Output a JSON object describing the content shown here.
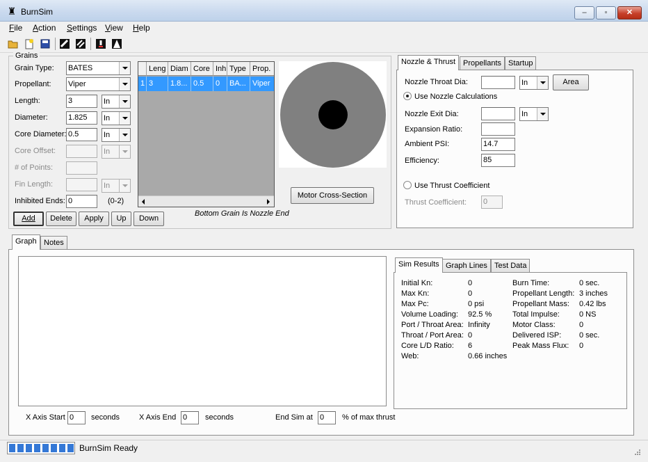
{
  "window": {
    "title": "BurnSim",
    "minimize_glyph": "–",
    "maximize_glyph": "▫",
    "close_glyph": "✕"
  },
  "menu": [
    {
      "label": "File",
      "accel": "F",
      "rest": "ile"
    },
    {
      "label": "Action",
      "accel": "A",
      "rest": "ction"
    },
    {
      "label": "Settings",
      "accel": "S",
      "rest": "ettings"
    },
    {
      "label": "View",
      "accel": "V",
      "rest": "iew"
    },
    {
      "label": "Help",
      "accel": "H",
      "rest": "elp"
    }
  ],
  "toolbar_icons": [
    "open-folder-icon",
    "new-file-icon",
    "save-disk-icon",
    "grain-tool-1-icon",
    "grain-tool-2-icon",
    "run-sim-icon",
    "motor-icon"
  ],
  "grains": {
    "legend": "Grains",
    "grain_type_label": "Grain Type:",
    "grain_type": "BATES",
    "propellant_label": "Propellant:",
    "propellant": "Viper",
    "length_label": "Length:",
    "length": "3",
    "length_unit": "In",
    "diameter_label": "Diameter:",
    "diameter": "1.825",
    "diameter_unit": "In",
    "core_diameter_label": "Core Diameter:",
    "core_diameter": "0.5",
    "core_diameter_unit": "In",
    "core_offset_label": "Core Offset:",
    "core_offset": "",
    "core_offset_unit": "In",
    "points_label": "# of Points:",
    "points": "",
    "fin_length_label": "Fin Length:",
    "fin_length": "",
    "fin_length_unit": "In",
    "inhibited_label": "Inhibited Ends:",
    "inhibited": "0",
    "inhibited_range": "(0-2)",
    "buttons": {
      "add": "Add",
      "delete": "Delete",
      "apply": "Apply",
      "up": "Up",
      "down": "Down"
    },
    "table": {
      "columns": [
        "Leng",
        "Diam",
        "Core",
        "Inh",
        "Type",
        "Prop."
      ],
      "rows": [
        {
          "index": "1",
          "cells": [
            "3",
            "1.8...",
            "0.5",
            "0",
            "BA...",
            "Viper"
          ]
        }
      ]
    },
    "nozzle_note": "Bottom Grain Is Nozzle End",
    "cross_section_button": "Motor Cross-Section"
  },
  "nozzle_tabs": [
    "Nozzle & Thrust",
    "Propellants",
    "Startup"
  ],
  "nozzle": {
    "throat_label": "Nozzle Throat Dia:",
    "throat": "",
    "throat_unit": "In",
    "area_button": "Area",
    "use_nozzle_calc": "Use Nozzle Calculations",
    "exit_label": "Nozzle Exit Dia:",
    "exit": "",
    "exit_unit": "In",
    "expansion_label": "Expansion Ratio:",
    "expansion": "",
    "ambient_label": "Ambient PSI:",
    "ambient": "14.7",
    "efficiency_label": "Efficiency:",
    "efficiency": "85",
    "use_thrust_coef": "Use Thrust Coefficient",
    "thrust_coef_label": "Thrust Coefficient:",
    "thrust_coef": "0"
  },
  "graph_tabs": [
    "Graph",
    "Notes"
  ],
  "results_tabs": [
    "Sim Results",
    "Graph Lines",
    "Test Data"
  ],
  "results_left": [
    {
      "label": "Initial Kn:",
      "value": "0"
    },
    {
      "label": "Max Kn:",
      "value": "0"
    },
    {
      "label": "Max Pc:",
      "value": "0 psi"
    },
    {
      "label": "Volume Loading:",
      "value": "92.5 %"
    },
    {
      "label": "Port / Throat Area:",
      "value": "Infinity"
    },
    {
      "label": "Throat / Port Area:",
      "value": "0"
    },
    {
      "label": "Core L/D Ratio:",
      "value": "6"
    },
    {
      "label": "Web:",
      "value": "0.66 inches"
    }
  ],
  "results_right": [
    {
      "label": "Burn Time:",
      "value": "0 sec."
    },
    {
      "label": "Propellant Length:",
      "value": "3 inches"
    },
    {
      "label": "Propellant Mass:",
      "value": "0.42 lbs"
    },
    {
      "label": "Total Impulse:",
      "value": "0 NS"
    },
    {
      "label": "Motor Class:",
      "value": "0"
    },
    {
      "label": "Delivered ISP:",
      "value": "0 sec."
    },
    {
      "label": "Peak Mass Flux:",
      "value": "0"
    }
  ],
  "axis": {
    "x_start_label": "X Axis Start",
    "x_start": "0",
    "x_start_unit": "seconds",
    "x_end_label": "X Axis End",
    "x_end": "0",
    "x_end_unit": "seconds",
    "end_sim_label": "End Sim at",
    "end_sim": "0",
    "end_sim_unit": "% of max thrust"
  },
  "status": {
    "text": "BurnSim Ready",
    "progress_blocks": 8
  },
  "colors": {
    "selection": "#3399ff",
    "grain_outer": "#808080",
    "grain_core": "#000000",
    "progress": "#3478d6"
  }
}
